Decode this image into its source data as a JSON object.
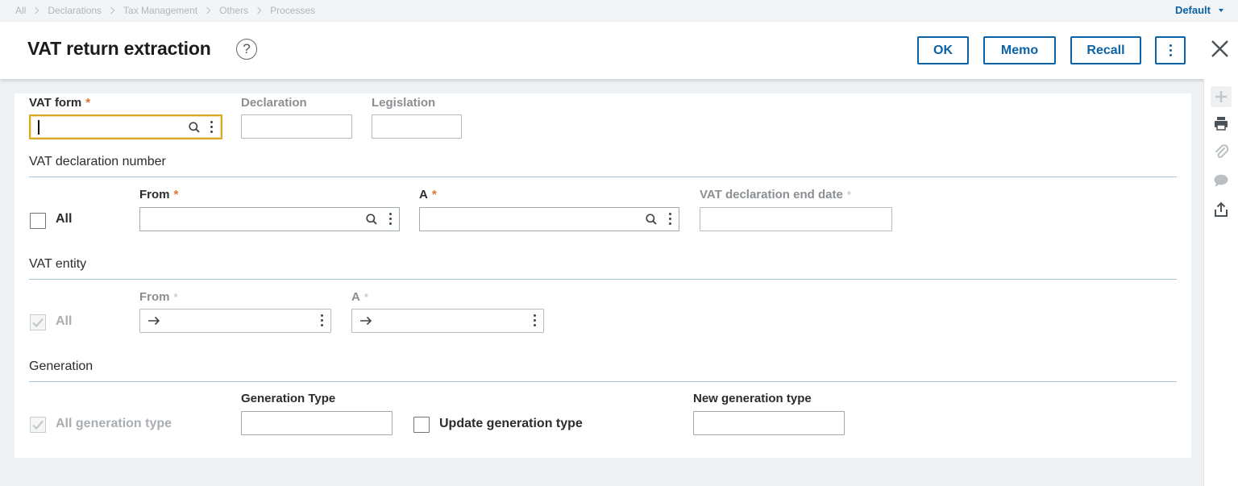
{
  "breadcrumb": [
    "All",
    "Declarations",
    "Tax Management",
    "Others",
    "Processes"
  ],
  "default_menu": "Default",
  "header": {
    "title": "VAT return extraction",
    "help": "?",
    "buttons": {
      "ok": "OK",
      "memo": "Memo",
      "recall": "Recall"
    }
  },
  "form": {
    "vat_form": {
      "label": "VAT form",
      "required": "*",
      "value": ""
    },
    "declaration": {
      "label": "Declaration",
      "value": ""
    },
    "legislation": {
      "label": "Legislation",
      "value": ""
    },
    "vat_declaration_number": {
      "title": "VAT declaration number",
      "all_label": "All",
      "all_checked": false,
      "from_label": "From",
      "to_label": "A",
      "end_date_label": "VAT declaration end date",
      "required": "*"
    },
    "vat_entity": {
      "title": "VAT entity",
      "all_label": "All",
      "all_checked": true,
      "from_label": "From",
      "to_label": "A",
      "required": "*"
    },
    "generation": {
      "title": "Generation",
      "all_label": "All generation type",
      "all_checked": true,
      "type_label": "Generation Type",
      "update_label": "Update generation type",
      "update_checked": false,
      "new_type_label": "New generation type"
    }
  },
  "icons": {
    "close": "close-icon",
    "right_toolbar": [
      "plus-icon",
      "print-icon",
      "paperclip-icon",
      "comment-icon",
      "share-icon"
    ]
  },
  "colors": {
    "accent": "#0b63a6",
    "required": "#e3702e",
    "focus": "#d9a722"
  }
}
